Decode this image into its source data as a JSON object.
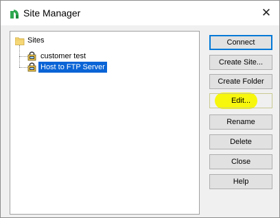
{
  "window": {
    "title": "Site Manager",
    "close_glyph": "✕"
  },
  "tree": {
    "root": {
      "label": "Sites",
      "icon": "folder-icon"
    },
    "items": [
      {
        "label": "customer test",
        "icon": "site-lock-icon",
        "selected": false
      },
      {
        "label": "Host to FTP Server",
        "icon": "site-lock-icon",
        "selected": true
      }
    ]
  },
  "buttons": {
    "connect": "Connect",
    "create_site": "Create Site...",
    "create_folder": "Create Folder",
    "edit": "Edit...",
    "rename": "Rename",
    "delete": "Delete",
    "close": "Close",
    "help": "Help"
  },
  "colors": {
    "selection": "#0a64d6",
    "highlight_marker": "#f7f700",
    "app_icon": "#2fa84f"
  }
}
